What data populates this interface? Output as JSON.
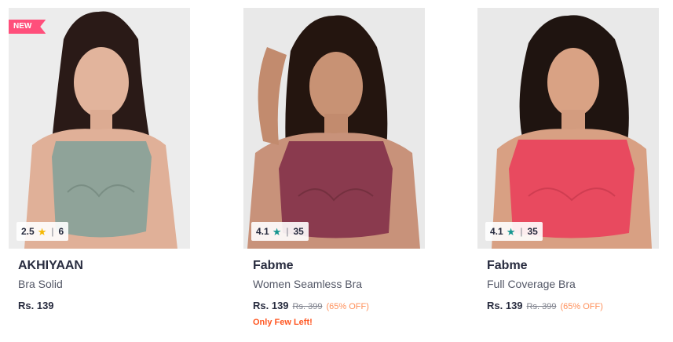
{
  "products": [
    {
      "badge": "NEW",
      "rating": "2.5",
      "rating_count": "6",
      "star_color": "#f5b800",
      "brand": "AKHIYAAN",
      "name": "Bra Solid",
      "price": "Rs. 139",
      "mrp": "",
      "discount": "",
      "stock_note": "",
      "garment_color": "#8fa399",
      "bg_color": "#ececec"
    },
    {
      "badge": "",
      "rating": "4.1",
      "rating_count": "35",
      "star_color": "#14958f",
      "brand": "Fabme",
      "name": "Women Seamless Bra",
      "price": "Rs. 139",
      "mrp": "Rs. 399",
      "discount": "(65% OFF)",
      "stock_note": "Only Few Left!",
      "garment_color": "#8a3a4e",
      "bg_color": "#e9e9e9"
    },
    {
      "badge": "",
      "rating": "4.1",
      "rating_count": "35",
      "star_color": "#14958f",
      "brand": "Fabme",
      "name": "Full Coverage Bra",
      "price": "Rs. 139",
      "mrp": "Rs. 399",
      "discount": "(65% OFF)",
      "stock_note": "",
      "garment_color": "#e84a5f",
      "bg_color": "#e9e9e9"
    }
  ]
}
